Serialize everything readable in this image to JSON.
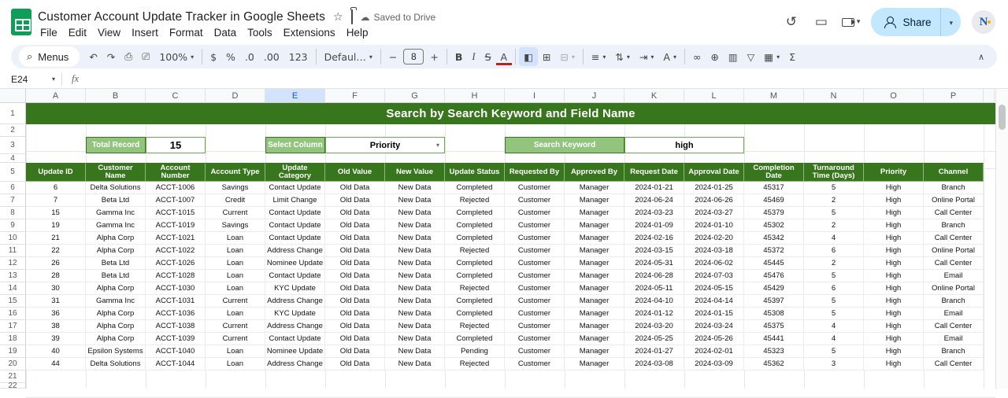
{
  "colors": {
    "dark_green": "#38761d",
    "mid_green": "#6aa84f",
    "light_green": "#93c47d",
    "logo_green": "#0f9d58",
    "share_blue": "#c2e7ff",
    "selected_header_blue": "#d3e3fd"
  },
  "topbar": {
    "title": "Customer Account Update Tracker in Google Sheets",
    "saved_status": "Saved to Drive",
    "menus": [
      "File",
      "Edit",
      "View",
      "Insert",
      "Format",
      "Data",
      "Tools",
      "Extensions",
      "Help"
    ],
    "share_label": "Share",
    "avatar_initial": "N"
  },
  "toolbar": {
    "menus_label": "Menus",
    "items": [
      {
        "type": "pill",
        "name": "menus-button",
        "glyph": "⌕",
        "label": "Menus"
      },
      {
        "type": "icon",
        "name": "undo-icon",
        "glyph": "↶"
      },
      {
        "type": "icon",
        "name": "redo-icon",
        "glyph": "↷"
      },
      {
        "type": "icon",
        "name": "print-icon",
        "glyph": "⎙"
      },
      {
        "type": "icon",
        "name": "paint-format-icon",
        "glyph": "⎚"
      },
      {
        "type": "select",
        "name": "zoom-select",
        "label": "100%"
      },
      {
        "type": "divider"
      },
      {
        "type": "icon",
        "name": "currency-format-icon",
        "glyph": "$"
      },
      {
        "type": "icon",
        "name": "percent-format-icon",
        "glyph": "%"
      },
      {
        "type": "icon",
        "name": "decrease-decimal-icon",
        "glyph": ".0"
      },
      {
        "type": "icon",
        "name": "increase-decimal-icon",
        "glyph": ".00"
      },
      {
        "type": "icon",
        "name": "more-formats-icon",
        "glyph": "123"
      },
      {
        "type": "divider"
      },
      {
        "type": "select",
        "name": "font-select",
        "label": "Defaul…"
      },
      {
        "type": "divider"
      },
      {
        "type": "icon",
        "name": "decrease-font-size-icon",
        "glyph": "−"
      },
      {
        "type": "sizebox",
        "name": "font-size-input",
        "label": "8"
      },
      {
        "type": "icon",
        "name": "increase-font-size-icon",
        "glyph": "+"
      },
      {
        "type": "divider"
      },
      {
        "type": "icon",
        "name": "bold-icon",
        "glyph": "B"
      },
      {
        "type": "icon",
        "name": "italic-icon",
        "glyph": "I"
      },
      {
        "type": "icon",
        "name": "strikethrough-icon",
        "glyph": "S"
      },
      {
        "type": "icon",
        "name": "text-color-icon",
        "glyph": "A"
      },
      {
        "type": "divider"
      },
      {
        "type": "icon",
        "name": "fill-color-icon",
        "glyph": "◧"
      },
      {
        "type": "icon",
        "name": "borders-icon",
        "glyph": "⊞"
      },
      {
        "type": "select",
        "name": "merge-cells-icon",
        "glyph": "⊟",
        "disabled": true
      },
      {
        "type": "divider"
      },
      {
        "type": "select",
        "name": "horizontal-align-icon",
        "glyph": "≡"
      },
      {
        "type": "select",
        "name": "vertical-align-icon",
        "glyph": "⇅"
      },
      {
        "type": "select",
        "name": "text-wrap-icon",
        "glyph": "⇥"
      },
      {
        "type": "select",
        "name": "text-rotation-icon",
        "glyph": "A"
      },
      {
        "type": "divider"
      },
      {
        "type": "icon",
        "name": "insert-link-icon",
        "glyph": "∞"
      },
      {
        "type": "icon",
        "name": "insert-comment-icon",
        "glyph": "⊕"
      },
      {
        "type": "icon",
        "name": "insert-chart-icon",
        "glyph": "▥"
      },
      {
        "type": "icon",
        "name": "create-filter-icon",
        "glyph": "▽"
      },
      {
        "type": "select",
        "name": "filter-views-icon",
        "glyph": "▦"
      },
      {
        "type": "icon",
        "name": "functions-icon",
        "glyph": "Σ"
      }
    ],
    "collapse_glyph": "∧"
  },
  "formula_bar": {
    "cell_ref": "E24",
    "fx_label": "fx"
  },
  "grid": {
    "columns": [
      "A",
      "B",
      "C",
      "D",
      "E",
      "F",
      "G",
      "H",
      "I",
      "J",
      "K",
      "L",
      "M",
      "N",
      "O",
      "P"
    ],
    "selected_column": "E",
    "rows": [
      1,
      2,
      3,
      4,
      5,
      6,
      7,
      8,
      9,
      10,
      11,
      12,
      13,
      14,
      15,
      16,
      17,
      18,
      19,
      20,
      21,
      22
    ]
  },
  "sheet": {
    "banner_title": "Search by Search Keyword and Field Name",
    "controls": {
      "total_record_label": "Total Record",
      "total_record_value": "15",
      "select_column_label": "Select Column",
      "select_column_value": "Priority",
      "search_keyword_label": "Search Keyword",
      "search_keyword_value": "high"
    },
    "table": {
      "headers": [
        "Update ID",
        "Customer Name",
        "Account Number",
        "Account Type",
        "Update Category",
        "Old Value",
        "New Value",
        "Update Status",
        "Requested By",
        "Approved By",
        "Request Date",
        "Approval Date",
        "Completion Date",
        "Turnaround Time (Days)",
        "Priority",
        "Channel"
      ],
      "rows": [
        [
          "6",
          "Delta Solutions",
          "ACCT-1006",
          "Savings",
          "Contact Update",
          "Old Data",
          "New Data",
          "Completed",
          "Customer",
          "Manager",
          "2024-01-21",
          "2024-01-25",
          "45317",
          "5",
          "High",
          "Branch"
        ],
        [
          "7",
          "Beta Ltd",
          "ACCT-1007",
          "Credit",
          "Limit Change",
          "Old Data",
          "New Data",
          "Rejected",
          "Customer",
          "Manager",
          "2024-06-24",
          "2024-06-26",
          "45469",
          "2",
          "High",
          "Online Portal"
        ],
        [
          "15",
          "Gamma Inc",
          "ACCT-1015",
          "Current",
          "Contact Update",
          "Old Data",
          "New Data",
          "Completed",
          "Customer",
          "Manager",
          "2024-03-23",
          "2024-03-27",
          "45379",
          "5",
          "High",
          "Call Center"
        ],
        [
          "19",
          "Gamma Inc",
          "ACCT-1019",
          "Savings",
          "Contact Update",
          "Old Data",
          "New Data",
          "Completed",
          "Customer",
          "Manager",
          "2024-01-09",
          "2024-01-10",
          "45302",
          "2",
          "High",
          "Branch"
        ],
        [
          "21",
          "Alpha Corp",
          "ACCT-1021",
          "Loan",
          "Contact Update",
          "Old Data",
          "New Data",
          "Completed",
          "Customer",
          "Manager",
          "2024-02-16",
          "2024-02-20",
          "45342",
          "4",
          "High",
          "Call Center"
        ],
        [
          "22",
          "Alpha Corp",
          "ACCT-1022",
          "Loan",
          "Address Change",
          "Old Data",
          "New Data",
          "Rejected",
          "Customer",
          "Manager",
          "2024-03-15",
          "2024-03-18",
          "45372",
          "6",
          "High",
          "Online Portal"
        ],
        [
          "26",
          "Beta Ltd",
          "ACCT-1026",
          "Loan",
          "Nominee Update",
          "Old Data",
          "New Data",
          "Completed",
          "Customer",
          "Manager",
          "2024-05-31",
          "2024-06-02",
          "45445",
          "2",
          "High",
          "Call Center"
        ],
        [
          "28",
          "Beta Ltd",
          "ACCT-1028",
          "Loan",
          "Contact Update",
          "Old Data",
          "New Data",
          "Completed",
          "Customer",
          "Manager",
          "2024-06-28",
          "2024-07-03",
          "45476",
          "5",
          "High",
          "Email"
        ],
        [
          "30",
          "Alpha Corp",
          "ACCT-1030",
          "Loan",
          "KYC Update",
          "Old Data",
          "New Data",
          "Rejected",
          "Customer",
          "Manager",
          "2024-05-11",
          "2024-05-15",
          "45429",
          "6",
          "High",
          "Online Portal"
        ],
        [
          "31",
          "Gamma Inc",
          "ACCT-1031",
          "Current",
          "Address Change",
          "Old Data",
          "New Data",
          "Completed",
          "Customer",
          "Manager",
          "2024-04-10",
          "2024-04-14",
          "45397",
          "5",
          "High",
          "Branch"
        ],
        [
          "36",
          "Alpha Corp",
          "ACCT-1036",
          "Loan",
          "KYC Update",
          "Old Data",
          "New Data",
          "Completed",
          "Customer",
          "Manager",
          "2024-01-12",
          "2024-01-15",
          "45308",
          "5",
          "High",
          "Email"
        ],
        [
          "38",
          "Alpha Corp",
          "ACCT-1038",
          "Current",
          "Address Change",
          "Old Data",
          "New Data",
          "Rejected",
          "Customer",
          "Manager",
          "2024-03-20",
          "2024-03-24",
          "45375",
          "4",
          "High",
          "Call Center"
        ],
        [
          "39",
          "Alpha Corp",
          "ACCT-1039",
          "Current",
          "Contact Update",
          "Old Data",
          "New Data",
          "Completed",
          "Customer",
          "Manager",
          "2024-05-25",
          "2024-05-26",
          "45441",
          "4",
          "High",
          "Email"
        ],
        [
          "40",
          "Epsilon Systems",
          "ACCT-1040",
          "Loan",
          "Nominee Update",
          "Old Data",
          "New Data",
          "Pending",
          "Customer",
          "Manager",
          "2024-01-27",
          "2024-02-01",
          "45323",
          "5",
          "High",
          "Branch"
        ],
        [
          "44",
          "Delta Solutions",
          "ACCT-1044",
          "Loan",
          "Address Change",
          "Old Data",
          "New Data",
          "Rejected",
          "Customer",
          "Manager",
          "2024-03-08",
          "2024-03-09",
          "45362",
          "3",
          "High",
          "Call Center"
        ]
      ]
    }
  }
}
